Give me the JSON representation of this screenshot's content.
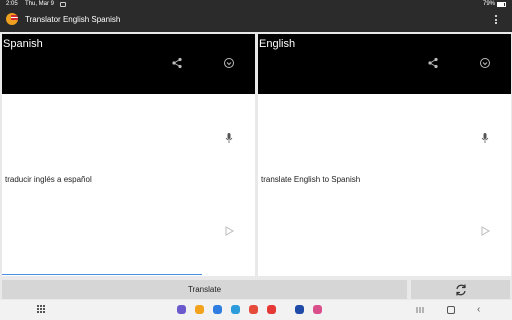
{
  "status_bar": {
    "time": "2:05",
    "date": "Thu, Mar 9",
    "battery": "79%"
  },
  "app_bar": {
    "title": "Translator English Spanish"
  },
  "source_panel": {
    "language": "Spanish",
    "text": "traducir inglés a español"
  },
  "target_panel": {
    "language": "English",
    "text": "translate English to Spanish"
  },
  "buttons": {
    "translate_label": "Translate"
  },
  "dock_apps": [
    {
      "name": "messages",
      "color": "#6a5acd"
    },
    {
      "name": "calendar",
      "color": "#f3a21b"
    },
    {
      "name": "files",
      "color": "#2f7de1"
    },
    {
      "name": "chat",
      "color": "#2d9cdb"
    },
    {
      "name": "calendar-red",
      "color": "#e64a3b"
    },
    {
      "name": "youtube",
      "color": "#e53935"
    },
    {
      "name": "settings",
      "color": "#1f4aa8"
    },
    {
      "name": "flower",
      "color": "#d94f8c"
    }
  ],
  "colors": {
    "bar_background": "#2b2b2b",
    "panel_header": "#000000",
    "accent": "#4a90e2"
  }
}
